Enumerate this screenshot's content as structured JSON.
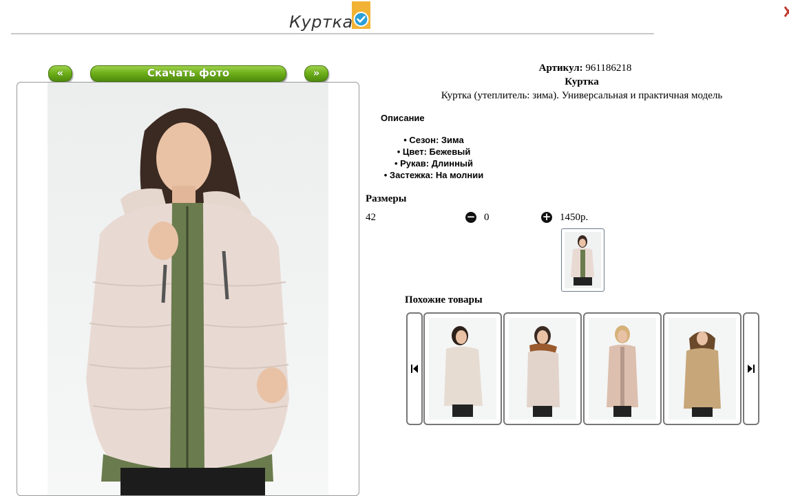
{
  "header": {
    "title": "Куртка"
  },
  "gallery": {
    "prev_label": "«",
    "download_label": "Скачать фото",
    "next_label": "»"
  },
  "product": {
    "article_label": "Артикул:",
    "article_value": "961186218",
    "name": "Куртка",
    "description": "Куртка (утеплитель: зима). Универсальная и практичная модель",
    "description_heading": "Описание",
    "attributes": [
      "Сезон: Зима",
      "Цвет: Бежевый",
      "Рукав: Длинный",
      "Застежка: На молнии"
    ]
  },
  "sizes": {
    "heading": "Размеры",
    "rows": [
      {
        "size": "42",
        "quantity": "0",
        "price": "1450р."
      }
    ]
  },
  "similar": {
    "heading": "Похожие товары",
    "items": [
      {
        "color": "#e6dcd2"
      },
      {
        "color": "#e2d4cb"
      },
      {
        "color": "#dcbfae"
      },
      {
        "color": "#c7a679"
      }
    ]
  },
  "colors": {
    "button_green": "#6fb11a",
    "verified_badge": "#f2b233",
    "verified_check": "#2a9fd6",
    "jacket_main": "#e8dad3",
    "vest_green": "#6a7b4d"
  },
  "icons": {
    "verified": "check-circle-icon",
    "close": "close-icon",
    "minus": "minus-circle-icon",
    "plus": "plus-circle-icon",
    "first": "skip-first-icon",
    "last": "skip-last-icon"
  }
}
